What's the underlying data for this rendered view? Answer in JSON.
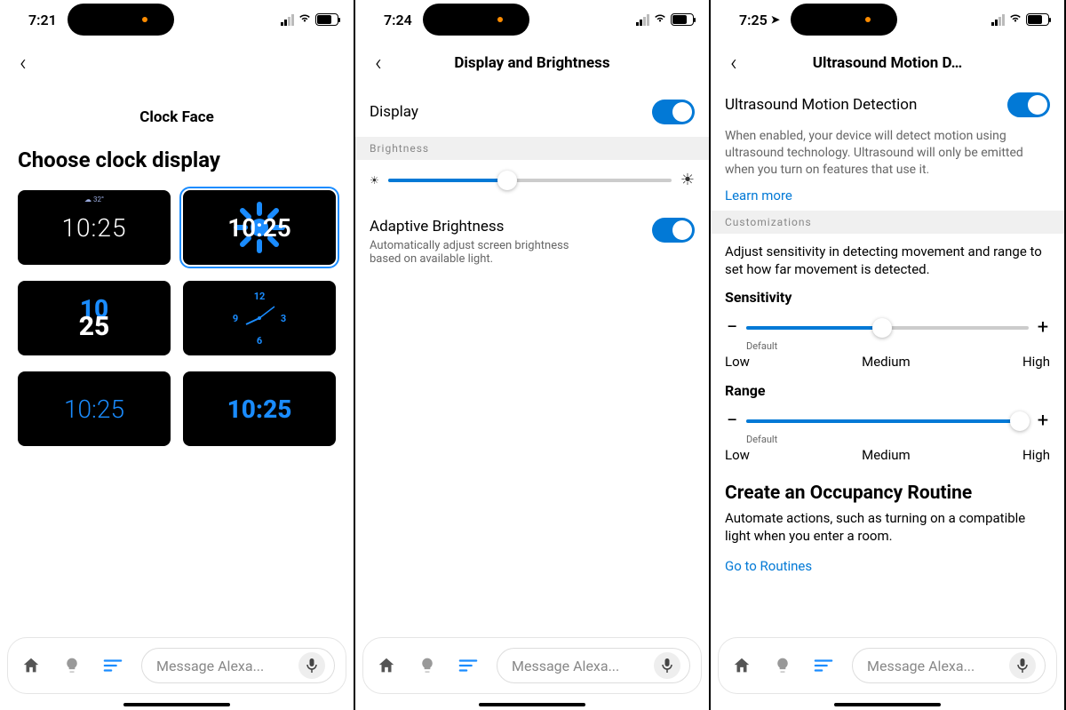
{
  "panel1": {
    "status": {
      "time": "7:21",
      "battery": "71",
      "battery_pct": 71
    },
    "title": "Clock Face",
    "heading": "Choose clock display",
    "tiles": [
      {
        "time": "10:25",
        "weather": "☁ 32°"
      },
      {
        "time": "10:25"
      },
      {
        "t1": "10",
        "t2": "25"
      },
      {
        "n12": "12",
        "n3": "3",
        "n6": "6",
        "n9": "9"
      },
      {
        "time": "10:25"
      },
      {
        "time": "10:25"
      }
    ]
  },
  "panel2": {
    "status": {
      "time": "7:24",
      "battery": "70",
      "battery_pct": 70
    },
    "title": "Display and Brightness",
    "display_label": "Display",
    "brightness_label": "Brightness",
    "brightness_pct": 42,
    "adaptive_label": "Adaptive Brightness",
    "adaptive_desc": "Automatically adjust screen brightness based on available light."
  },
  "panel3": {
    "status": {
      "time": "7:25",
      "battery": "70",
      "battery_pct": 70,
      "loc": true
    },
    "title": "Ultrasound Motion D…",
    "toggle_label": "Ultrasound Motion Detection",
    "desc": "When enabled, your device will detect motion using ultrasound technology. Ultrasound will only be emitted when you turn on features that use it.",
    "learn_more": "Learn more",
    "cust_label": "Customizations",
    "cust_desc": "Adjust sensitivity in detecting movement and range to set how far movement is detected.",
    "sensitivity_label": "Sensitivity",
    "sensitivity_pct": 48,
    "range_label": "Range",
    "range_pct": 97,
    "default_label": "Default",
    "low": "Low",
    "medium": "Medium",
    "high": "High",
    "routine_head": "Create an Occupancy Routine",
    "routine_desc": "Automate actions, such as turning on a compatible light when you enter a room.",
    "routines_link": "Go to Routines"
  },
  "dock": {
    "placeholder": "Message Alexa..."
  }
}
